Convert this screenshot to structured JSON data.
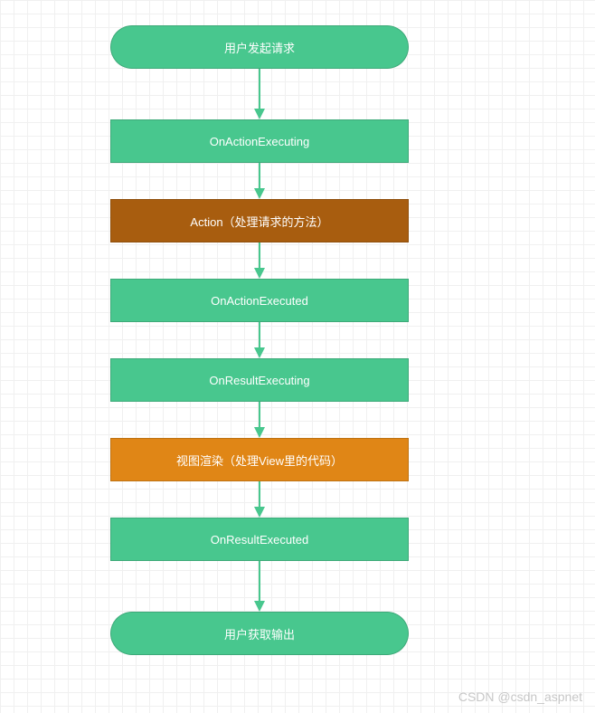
{
  "chart_data": {
    "type": "flowchart",
    "nodes": [
      {
        "id": "n1",
        "label": "用户发起请求",
        "shape": "rounded",
        "color": "#48c78e"
      },
      {
        "id": "n2",
        "label": "OnActionExecuting",
        "shape": "rect",
        "color": "#48c78e"
      },
      {
        "id": "n3",
        "label": "Action（处理请求的方法）",
        "shape": "rect",
        "color": "#a85d0f"
      },
      {
        "id": "n4",
        "label": "OnActionExecuted",
        "shape": "rect",
        "color": "#48c78e"
      },
      {
        "id": "n5",
        "label": "OnResultExecuting",
        "shape": "rect",
        "color": "#48c78e"
      },
      {
        "id": "n6",
        "label": "视图渲染（处理View里的代码）",
        "shape": "rect",
        "color": "#e08616"
      },
      {
        "id": "n7",
        "label": "OnResultExecuted",
        "shape": "rect",
        "color": "#48c78e"
      },
      {
        "id": "n8",
        "label": "用户获取输出",
        "shape": "rounded",
        "color": "#48c78e"
      }
    ],
    "edges": [
      {
        "from": "n1",
        "to": "n2"
      },
      {
        "from": "n2",
        "to": "n3"
      },
      {
        "from": "n3",
        "to": "n4"
      },
      {
        "from": "n4",
        "to": "n5"
      },
      {
        "from": "n5",
        "to": "n6"
      },
      {
        "from": "n6",
        "to": "n7"
      },
      {
        "from": "n7",
        "to": "n8"
      }
    ]
  },
  "watermark": "CSDN @csdn_aspnet"
}
